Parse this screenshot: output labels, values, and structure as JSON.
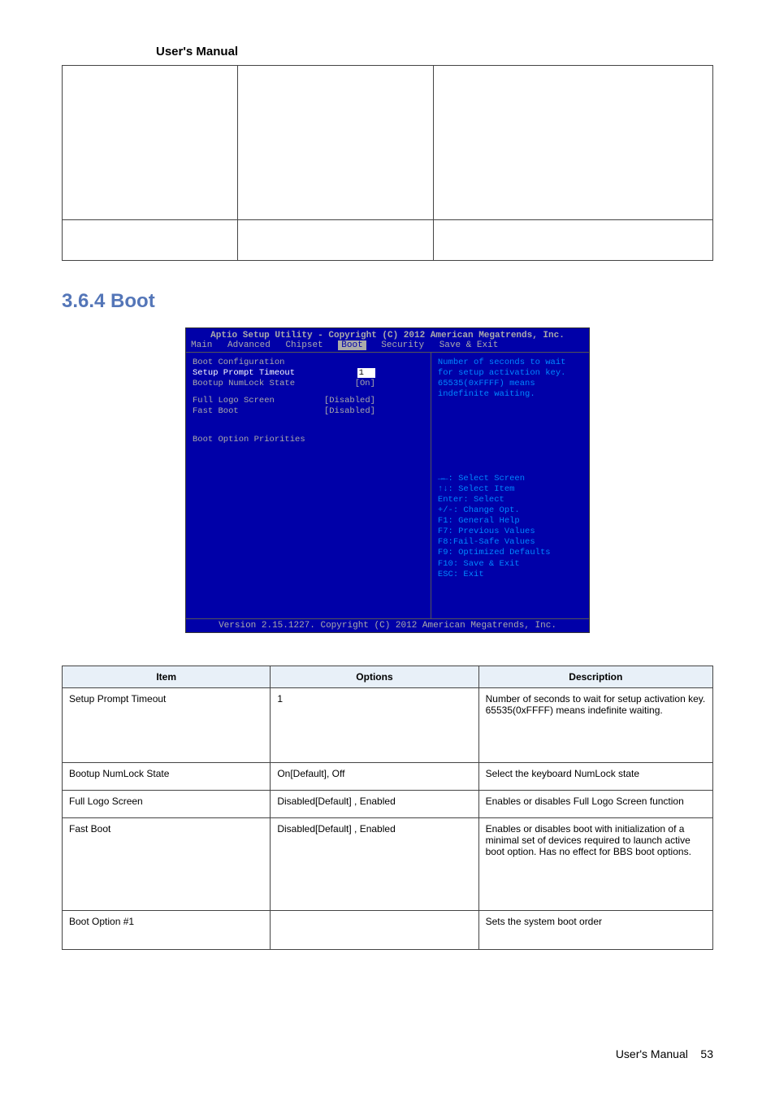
{
  "header": {
    "title": "User's Manual"
  },
  "section": {
    "heading": "3.6.4 Boot"
  },
  "bios": {
    "title": "Aptio Setup Utility - Copyright (C) 2012 American Megatrends, Inc.",
    "menu": [
      "Main",
      "Advanced",
      "Chipset",
      "Boot",
      "Security",
      "Save & Exit"
    ],
    "active_menu": "Boot",
    "items": [
      {
        "label": "Boot Configuration",
        "value": "",
        "cls": "gray"
      },
      {
        "label": "Setup Prompt Timeout",
        "value": "1",
        "cls": "white",
        "sel": true
      },
      {
        "label": "Bootup NumLock State",
        "value": "[On]",
        "cls": "gray"
      }
    ],
    "items2": [
      {
        "label": "Full Logo Screen",
        "value": "[Disabled]",
        "cls": "gray"
      },
      {
        "label": "Fast Boot",
        "value": "[Disabled]",
        "cls": "gray"
      }
    ],
    "section2": "Boot Option Priorities",
    "help": "Number of seconds to wait for setup activation key. 65535(0xFFFF) means indefinite waiting.",
    "keys": [
      "→←: Select Screen",
      "↑↓: Select Item",
      "Enter: Select",
      "+/-: Change Opt.",
      "F1: General Help",
      "F7: Previous Values",
      "F8:Fail-Safe Values",
      "F9: Optimized Defaults",
      "F10: Save & Exit",
      "ESC: Exit"
    ],
    "footer": "Version 2.15.1227. Copyright (C) 2012 American Megatrends, Inc."
  },
  "spec_table": {
    "headers": [
      "Item",
      "Options",
      "Description"
    ],
    "rows": [
      {
        "h": "r-h1",
        "cells": [
          "Setup Prompt Timeout",
          "1",
          "Number of seconds to wait for setup activation key.\n65535(0xFFFF) means indefinite waiting."
        ]
      },
      {
        "h": "r-norm",
        "cells": [
          "Bootup NumLock State",
          "On[Default],\nOff",
          "Select the keyboard NumLock state"
        ]
      },
      {
        "h": "r-norm",
        "cells": [
          "Full Logo Screen",
          "Disabled[Default] ,\nEnabled",
          "Enables or disables Full Logo Screen function"
        ]
      },
      {
        "h": "r-mid",
        "cells": [
          "Fast Boot",
          "Disabled[Default] ,\nEnabled",
          "Enables or disables boot with initialization of a minimal set of devices required to launch active boot option. Has no effect for BBS boot options."
        ]
      },
      {
        "h": "r-lo",
        "cells": [
          "Boot Option #1",
          "",
          "Sets the system boot order"
        ]
      }
    ]
  },
  "footer": {
    "text": "User's Manual",
    "page": "53"
  }
}
